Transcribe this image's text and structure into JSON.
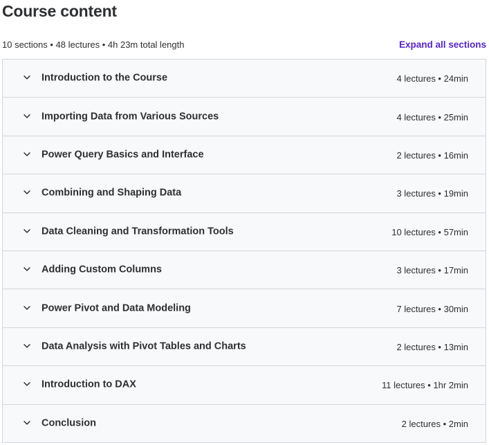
{
  "header": {
    "title": "Course content",
    "summary": "10 sections • 48 lectures • 4h 23m total length",
    "expand_label": "Expand all sections"
  },
  "sections": [
    {
      "title": "Introduction to the Course",
      "meta": "4 lectures • 24min"
    },
    {
      "title": "Importing Data from Various Sources",
      "meta": "4 lectures • 25min"
    },
    {
      "title": "Power Query Basics and Interface",
      "meta": "2 lectures • 16min"
    },
    {
      "title": "Combining and Shaping Data",
      "meta": "3 lectures • 19min"
    },
    {
      "title": "Data Cleaning and Transformation Tools",
      "meta": "10 lectures • 57min"
    },
    {
      "title": "Adding Custom Columns",
      "meta": "3 lectures • 17min"
    },
    {
      "title": "Power Pivot and Data Modeling",
      "meta": "7 lectures • 30min"
    },
    {
      "title": "Data Analysis with Pivot Tables and Charts",
      "meta": "2 lectures • 13min"
    },
    {
      "title": "Introduction to DAX",
      "meta": "11 lectures • 1hr 2min"
    },
    {
      "title": "Conclusion",
      "meta": "2 lectures • 2min"
    }
  ],
  "icons": {
    "section_toggle": "chevron-down-icon"
  },
  "colors": {
    "accent": "#5624d0",
    "text": "#2d2f31",
    "section_bg": "#f7f9fa",
    "border": "#d1d7dc"
  }
}
